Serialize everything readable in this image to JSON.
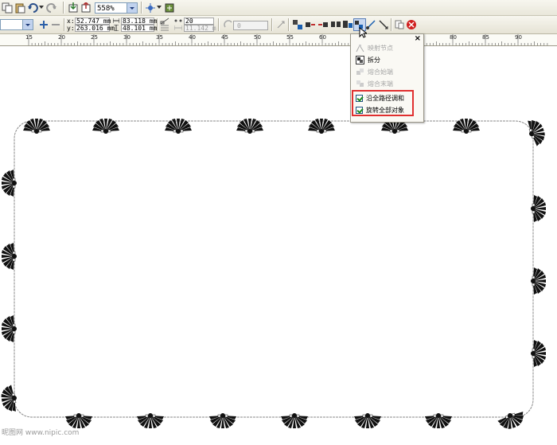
{
  "toolbar": {
    "zoom_value": "558%",
    "x_label": "x:",
    "y_label": "y:",
    "x_value": "52.747 mm",
    "y_value": "263.016 mm",
    "width_value": "83.118 mm",
    "height_value": "48.101 mm",
    "secondary_value": "11.142 m",
    "steps_value": "20",
    "offset_value": "0"
  },
  "ruler": {
    "ticks": [
      "15",
      "20",
      "25",
      "30",
      "35",
      "40",
      "45",
      "50",
      "55",
      "60",
      "65",
      "70",
      "75",
      "80",
      "85",
      "90"
    ]
  },
  "popup_menu": {
    "close_label": "×",
    "items": [
      {
        "label": "映射节点",
        "enabled": false
      },
      {
        "label": "拆分",
        "enabled": true
      },
      {
        "label": "熔合始端",
        "enabled": false
      },
      {
        "label": "熔合末端",
        "enabled": false
      }
    ],
    "checkboxes": [
      {
        "label": "沿全路径调和",
        "checked": true
      },
      {
        "label": "旋转全部对象",
        "checked": true
      }
    ]
  },
  "watermark": "昵图网 www.nipic.com",
  "colors": {
    "toolbar_bg": "#ece9d8",
    "highlight": "#e03030",
    "path": "#888888",
    "object_fill": "#000000"
  }
}
